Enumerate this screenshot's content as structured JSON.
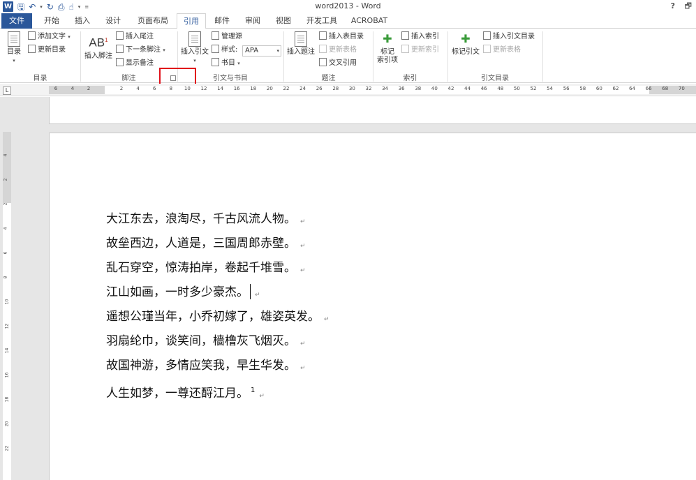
{
  "app": {
    "title": "word2013 - Word",
    "help": "?",
    "window_controls": "🗗"
  },
  "quick_access": {
    "logo": "W",
    "save_icon": "save-icon",
    "undo_icon": "undo-icon",
    "redo_icon": "redo-icon",
    "preview_icon": "print-preview-icon",
    "customize_icon": "customize-icon"
  },
  "tabs": [
    "文件",
    "开始",
    "插入",
    "设计",
    "页面布局",
    "引用",
    "邮件",
    "审阅",
    "视图",
    "开发工具",
    "ACROBAT"
  ],
  "active_tab": "引用",
  "ribbon": {
    "toc": {
      "group": "目录",
      "toc_button": "目录",
      "add_text": "添加文字",
      "update_toc": "更新目录"
    },
    "footnotes": {
      "group": "脚注",
      "insert_footnote": "插入脚注",
      "insert_endnote": "插入尾注",
      "next_footnote": "下一条脚注",
      "show_notes": "显示备注"
    },
    "citations": {
      "group": "引文与书目",
      "insert_citation": "插入引文",
      "manage_sources": "管理源",
      "style_label": "样式:",
      "style_value": "APA",
      "bibliography": "书目"
    },
    "captions": {
      "group": "题注",
      "insert_caption": "插入题注",
      "insert_table_of_figures": "插入表目录",
      "update_table": "更新表格",
      "cross_reference": "交叉引用"
    },
    "index": {
      "group": "索引",
      "mark_entry_l1": "标记",
      "mark_entry_l2": "索引项",
      "insert_index": "插入索引",
      "update_index": "更新索引"
    },
    "authorities": {
      "group": "引文目录",
      "mark_citation": "标记引文",
      "insert_table_of_authorities": "插入引文目录",
      "update_table": "更新表格"
    }
  },
  "ruler": {
    "corner": "L",
    "ticks": [
      "6",
      "4",
      "2",
      "2",
      "4",
      "6",
      "8",
      "10",
      "12",
      "14",
      "16",
      "18",
      "20",
      "22",
      "24",
      "26",
      "28",
      "30",
      "32",
      "34",
      "36",
      "38",
      "40",
      "42",
      "44",
      "46",
      "48",
      "50",
      "52",
      "54",
      "56",
      "58",
      "60",
      "62",
      "64",
      "66",
      "68",
      "70"
    ],
    "vticks": [
      "4",
      "2",
      "2",
      "4",
      "6",
      "8",
      "10",
      "12",
      "14",
      "16",
      "18",
      "20",
      "22"
    ]
  },
  "document": {
    "paragraph_mark": "↵",
    "lines": [
      "大江东去，浪淘尽，千古风流人物。",
      "故垒西边，人道是，三国周郎赤壁。",
      "乱石穿空，惊涛拍岸，卷起千堆雪。",
      "江山如画，一时多少豪杰。",
      "遥想公瑾当年，小乔初嫁了，雄姿英发。",
      "羽扇纶巾，谈笑间，樯橹灰飞烟灭。",
      "故国神游，多情应笑我，早生华发。",
      "人生如梦，一尊还酹江月。"
    ],
    "footnote_ref": "1"
  },
  "colors": {
    "brand": "#2b579a",
    "highlight_box": "#e0101a"
  }
}
